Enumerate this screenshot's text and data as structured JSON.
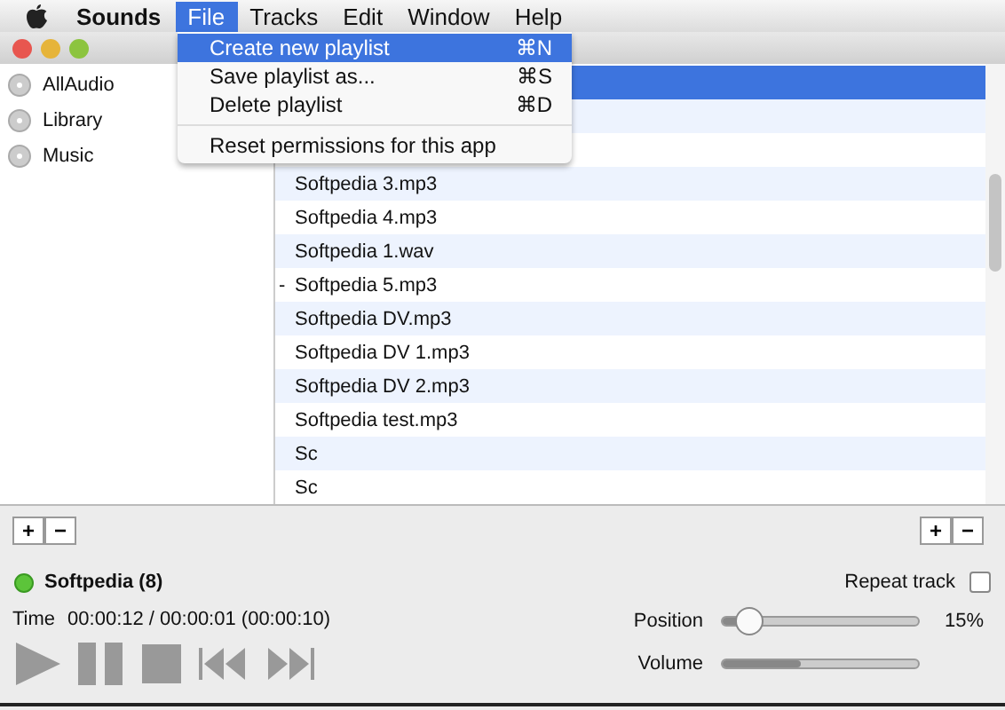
{
  "menubar": {
    "app": "Sounds",
    "menus": [
      {
        "label": "File",
        "selected": true
      },
      {
        "label": "Tracks",
        "selected": false
      },
      {
        "label": "Edit",
        "selected": false
      },
      {
        "label": "Window",
        "selected": false
      },
      {
        "label": "Help",
        "selected": false
      }
    ]
  },
  "sidebar": {
    "items": [
      {
        "label": "AllAudio",
        "selected": false
      },
      {
        "label": "Library",
        "selected": false
      },
      {
        "label": "Music",
        "selected": false
      }
    ]
  },
  "playlist": {
    "rows": [
      {
        "selected": true
      },
      {
        "selected": false
      },
      {
        "selected": false
      },
      {
        "label": "Softpedia 3.mp3",
        "selected": false
      },
      {
        "label": "Softpedia 4.mp3",
        "selected": false
      },
      {
        "label": "Softpedia 1.wav",
        "selected": false
      },
      {
        "label": "Softpedia 5.mp3",
        "marker": "-",
        "selected": false
      },
      {
        "label": "Softpedia DV.mp3",
        "selected": false
      },
      {
        "label": "Softpedia DV 1.mp3",
        "selected": false
      },
      {
        "label": "Softpedia DV 2.mp3",
        "selected": false
      },
      {
        "label": "Softpedia test.mp3",
        "selected": false
      },
      {
        "label": "Sc",
        "selected": false
      },
      {
        "label": "Sc",
        "selected": false
      }
    ]
  },
  "file_menu": {
    "items": [
      {
        "kind": "item",
        "label": "Create new playlist",
        "shortcut": "⌘N",
        "selected": true
      },
      {
        "kind": "item",
        "label": "Save playlist as...",
        "shortcut": "⌘S",
        "selected": false
      },
      {
        "kind": "item",
        "label": "Delete playlist",
        "shortcut": "⌘D",
        "selected": false
      },
      {
        "kind": "separator"
      },
      {
        "kind": "item",
        "label": "Reset permissions for this app",
        "selected": false
      }
    ]
  },
  "player": {
    "sidebar_buttons": [
      "+",
      "−"
    ],
    "playlist_buttons": [
      "+",
      "−"
    ],
    "now_playing": "Softpedia (8)",
    "time_label": "Time",
    "time": "00:00:12 / 00:00:01 (00:00:10)",
    "repeat": {
      "label": "Repeat track",
      "checked": false
    },
    "position": {
      "label": "Position",
      "level": 0.15,
      "reading": "15%"
    },
    "volume": {
      "label": "Volume",
      "level": 0.4
    }
  }
}
